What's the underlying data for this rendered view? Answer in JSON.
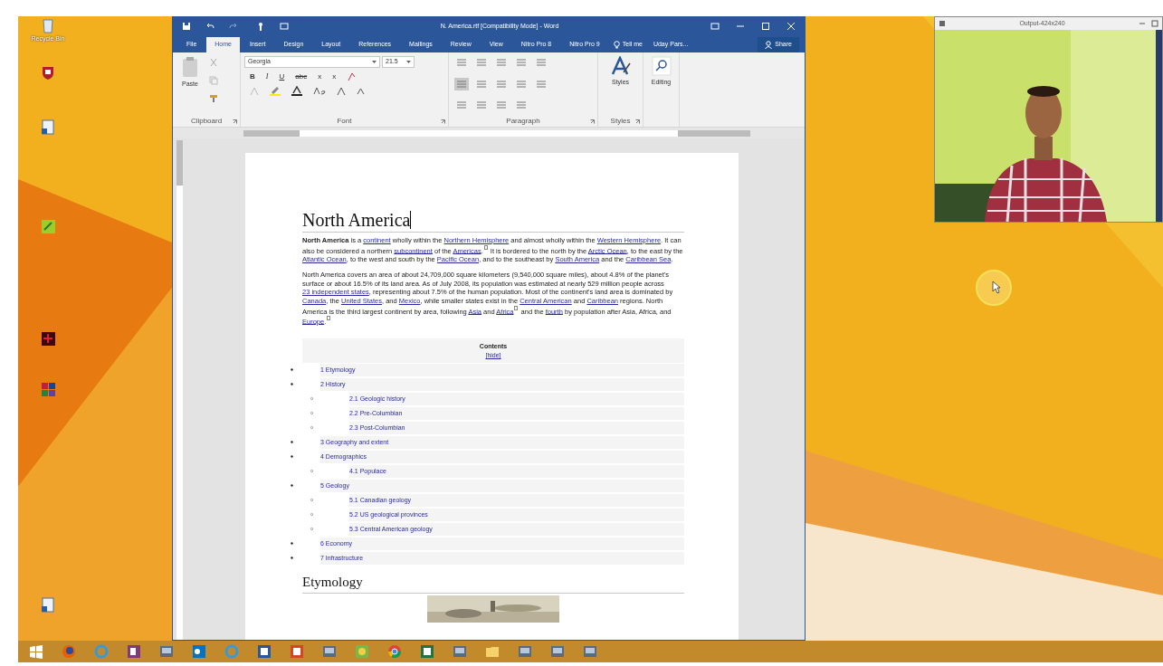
{
  "desktop_icons": [
    {
      "kind": "bin",
      "label": "Recycle Bin"
    },
    {
      "kind": "shield"
    },
    {
      "kind": "doc"
    },
    {
      "kind": "green"
    },
    {
      "kind": "dark"
    },
    {
      "kind": "grid"
    },
    {
      "kind": "doc"
    }
  ],
  "word": {
    "title": "N. America.rtf [Compatibility Mode] - Word",
    "tabs": [
      {
        "label": "File",
        "selected": false
      },
      {
        "label": "Home",
        "selected": true
      },
      {
        "label": "Insert",
        "selected": false
      },
      {
        "label": "Design",
        "selected": false
      },
      {
        "label": "Layout",
        "selected": false
      },
      {
        "label": "References",
        "selected": false
      },
      {
        "label": "Mailings",
        "selected": false
      },
      {
        "label": "Review",
        "selected": false
      },
      {
        "label": "View",
        "selected": false
      },
      {
        "label": "Nitro Pro 8",
        "selected": false
      },
      {
        "label": "Nitro Pro 9",
        "selected": false
      }
    ],
    "tell_me": "Tell me",
    "user": "Uday Pars...",
    "share": "Share",
    "paste": "Paste",
    "font_name": "Georgia",
    "font_size": "21.5",
    "font_buttons": [
      "B",
      "I",
      "U",
      "abc",
      "x",
      "x"
    ],
    "styles": "Styles",
    "editing": "Editing",
    "groups": [
      "Clipboard",
      "Font",
      "Paragraph",
      "Styles"
    ]
  },
  "document": {
    "heading": "North America",
    "paragraphs": [
      [
        {
          "kind": "bold",
          "text": "North America"
        },
        {
          "kind": "text",
          "text": " is a "
        },
        {
          "kind": "link",
          "text": "continent"
        },
        {
          "kind": "text",
          "text": " wholly within the "
        },
        {
          "kind": "link",
          "text": "Northern Hemisphere"
        },
        {
          "kind": "text",
          "text": " and almost wholly within the "
        },
        {
          "kind": "link",
          "text": "Western Hemisphere"
        },
        {
          "kind": "text",
          "text": ".   It can also be considered a northern "
        },
        {
          "kind": "link",
          "text": "subcontinent"
        },
        {
          "kind": "text",
          "text": " of the "
        },
        {
          "kind": "link",
          "text": "Americas"
        },
        {
          "kind": "text",
          "text": "."
        },
        {
          "kind": "ref"
        },
        {
          "kind": "text",
          "text": " It is bordered to the north by the "
        },
        {
          "kind": "link",
          "text": "Arctic Ocean"
        },
        {
          "kind": "text",
          "text": ", to the east by the "
        },
        {
          "kind": "link",
          "text": "Atlantic Ocean"
        },
        {
          "kind": "text",
          "text": ", to the west and south by the "
        },
        {
          "kind": "link",
          "text": "Pacific Ocean"
        },
        {
          "kind": "text",
          "text": ", and to the southeast by "
        },
        {
          "kind": "link",
          "text": "South America"
        },
        {
          "kind": "text",
          "text": " and the "
        },
        {
          "kind": "link",
          "text": "Caribbean Sea"
        },
        {
          "kind": "text",
          "text": "."
        }
      ],
      [
        {
          "kind": "text",
          "text": "North America covers an area of about 24,709,000 square kilometers (9,540,000 square miles), about 4.8% of the planet's surface or about 16.5% of its land area.   As of July 2008, its population was estimated at nearly 529 million people across "
        },
        {
          "kind": "link",
          "text": "23 independent states"
        },
        {
          "kind": "text",
          "text": ", representing about 7.5% of the human population. Most of the continent's land area is dominated by "
        },
        {
          "kind": "link",
          "text": "Canada"
        },
        {
          "kind": "text",
          "text": ", the "
        },
        {
          "kind": "link",
          "text": "United States"
        },
        {
          "kind": "text",
          "text": ", and "
        },
        {
          "kind": "link",
          "text": "Mexico"
        },
        {
          "kind": "text",
          "text": ", while smaller states exist in the "
        },
        {
          "kind": "link",
          "text": "Central American"
        },
        {
          "kind": "text",
          "text": " and "
        },
        {
          "kind": "link",
          "text": "Caribbean"
        },
        {
          "kind": "text",
          "text": " regions. North America is the third largest continent by area, following "
        },
        {
          "kind": "link",
          "text": "Asia"
        },
        {
          "kind": "text",
          "text": " and "
        },
        {
          "kind": "link",
          "text": "Africa"
        },
        {
          "kind": "ref"
        },
        {
          "kind": "text",
          "text": " and the "
        },
        {
          "kind": "link",
          "text": "fourth"
        },
        {
          "kind": "text",
          "text": " by population after Asia, Africa, and "
        },
        {
          "kind": "link",
          "text": "Europe"
        },
        {
          "kind": "text",
          "text": "."
        },
        {
          "kind": "ref"
        }
      ]
    ],
    "toc": {
      "title": "Contents",
      "toggle": "[hide]",
      "items": [
        {
          "label": "1 Etymology"
        },
        {
          "label": "2 History",
          "children": [
            {
              "label": "2.1 Geologic history"
            },
            {
              "label": "2.2 Pre-Columbian"
            },
            {
              "label": "2.3 Post-Columbian"
            }
          ]
        },
        {
          "label": "3 Geography and extent"
        },
        {
          "label": "4 Demographics",
          "children": [
            {
              "label": "4.1 Populace"
            }
          ]
        },
        {
          "label": "5 Geology",
          "children": [
            {
              "label": "5.1 Canadian geology"
            },
            {
              "label": "5.2 US geological provinces"
            },
            {
              "label": "5.3 Central American geology"
            }
          ]
        },
        {
          "label": "6 Economy"
        },
        {
          "label": "7 Infrastructure"
        }
      ]
    },
    "section_heading": "Etymology"
  },
  "webcam": {
    "title": "Output-424x240"
  },
  "taskbar": [
    {
      "kind": "start"
    },
    {
      "kind": "firefox"
    },
    {
      "kind": "ie"
    },
    {
      "kind": "onenote"
    },
    {
      "kind": "app"
    },
    {
      "kind": "outlook"
    },
    {
      "kind": "ie"
    },
    {
      "kind": "word"
    },
    {
      "kind": "powerpoint"
    },
    {
      "kind": "app"
    },
    {
      "kind": "paint"
    },
    {
      "kind": "chrome"
    },
    {
      "kind": "excel"
    },
    {
      "kind": "app"
    },
    {
      "kind": "folder"
    },
    {
      "kind": "app"
    },
    {
      "kind": "app"
    },
    {
      "kind": "app"
    }
  ]
}
